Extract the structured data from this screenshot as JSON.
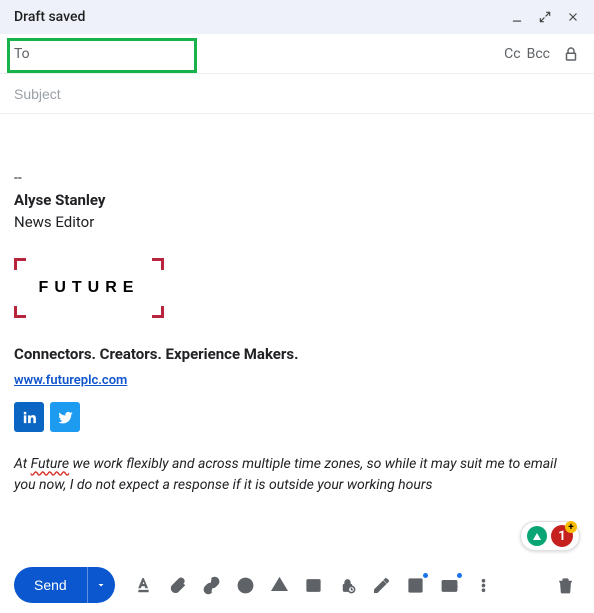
{
  "header": {
    "title": "Draft saved"
  },
  "to": {
    "label": "To",
    "value": "",
    "cc": "Cc",
    "bcc": "Bcc"
  },
  "subject": {
    "placeholder": "Subject",
    "value": ""
  },
  "signature": {
    "dashes": "--",
    "name": "Alyse Stanley",
    "role": "News Editor",
    "logo_text": "FUTURE",
    "tagline": "Connectors. Creators. Experience Makers.",
    "link_text": "www.futureplc.com"
  },
  "disclaimer": {
    "prefix": "At ",
    "underlined": "Future",
    "rest": " we work flexibly and across multiple time zones, so while it may suit me to email you now, I do not expect a response if it is outside your working hours"
  },
  "badge": {
    "count": "1",
    "plus": "+"
  },
  "send": {
    "label": "Send"
  }
}
